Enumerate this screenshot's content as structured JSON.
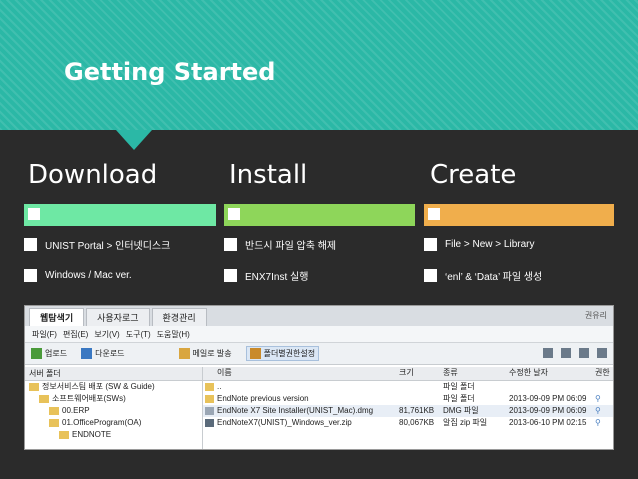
{
  "title": "Getting Started",
  "colors": {
    "header": "#2bb8a6",
    "download": "#6ee8a4",
    "install": "#8ed65a",
    "create": "#f0ae4c",
    "bg": "#2b2b2b"
  },
  "columns": [
    {
      "title": "Download",
      "items": [
        "UNIST Portal > 인터넷디스크",
        "Windows / Mac ver."
      ]
    },
    {
      "title": "Install",
      "items": [
        "반드시 파일 압축 해제",
        "ENX7Inst 실행"
      ]
    },
    {
      "title": "Create",
      "items": [
        "File > New > Library",
        "‘enl’ & ‘Data’ 파일 생성"
      ]
    }
  ],
  "explorer": {
    "tabs": [
      "웹탐색기",
      "사용자로그",
      "환경관리"
    ],
    "top_right": "권유리",
    "menu": [
      "파일(F)",
      "편집(E)",
      "보기(V)",
      "도구(T)",
      "도움말(H)"
    ],
    "toolbar": [
      "업로드",
      "다운로드",
      "메일로 발송",
      "폴더별권한설정"
    ],
    "tree_header": "서버 폴더",
    "tree": [
      "정보서비스팀 배포 (SW & Guide)",
      "소프트웨어배포(SWs)",
      "00.ERP",
      "01.OfficeProgram(OA)",
      "ENDNOTE"
    ],
    "columns": {
      "name": "이름",
      "size": "크기",
      "type": "종류",
      "date": "수정한 날자",
      "auth": "권한"
    },
    "files": [
      {
        "name": "..",
        "size": "",
        "type": "파일 폴더",
        "date": "",
        "auth": ""
      },
      {
        "name": "EndNote previous version",
        "size": "",
        "type": "파일 폴더",
        "date": "2013-09-09 PM 06:09",
        "auth": ""
      },
      {
        "name": "EndNote X7 Site Installer(UNIST_Mac).dmg",
        "size": "81,761KB",
        "type": "DMG 파일",
        "date": "2013-09-09 PM 06:09",
        "auth": ""
      },
      {
        "name": "EndNoteX7(UNIST)_Windows_ver.zip",
        "size": "80,067KB",
        "type": "알집 zip 파일",
        "date": "2013-06-10 PM 02:15",
        "auth": ""
      }
    ]
  }
}
